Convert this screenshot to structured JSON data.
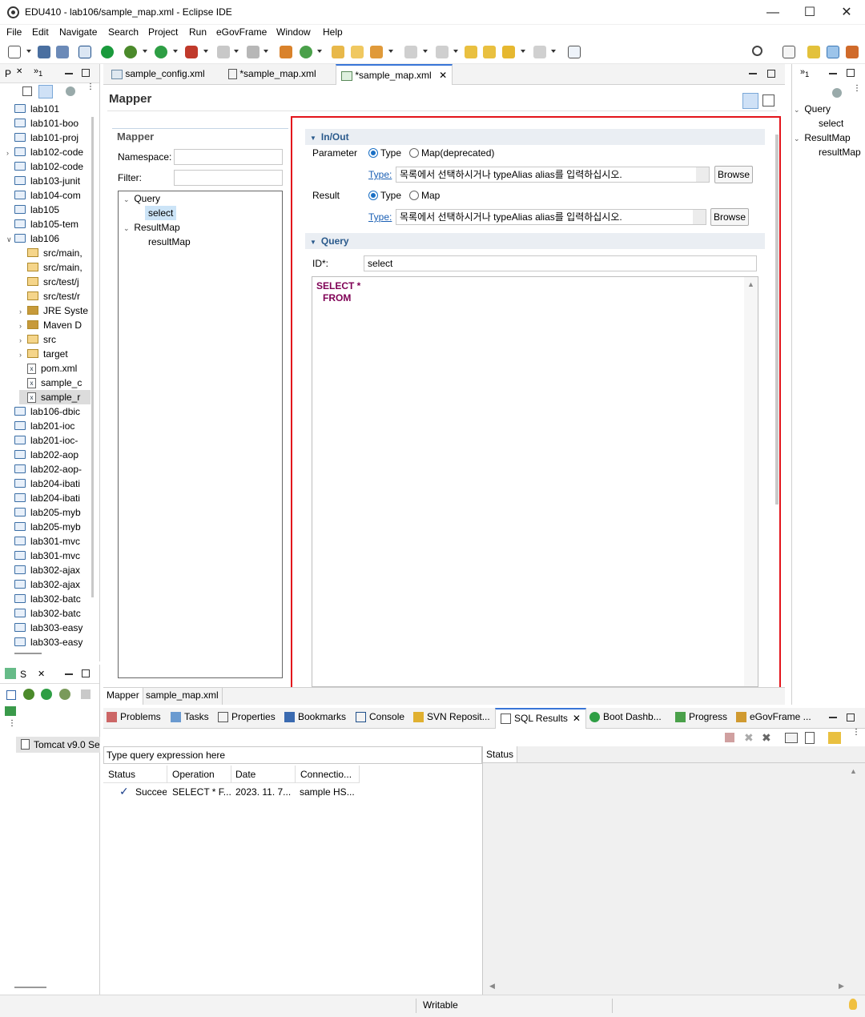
{
  "window": {
    "title": "EDU410 - lab106/sample_map.xml - Eclipse IDE"
  },
  "menu": [
    "File",
    "Edit",
    "Navigate",
    "Search",
    "Project",
    "Run",
    "eGovFrame",
    "Window",
    "Help"
  ],
  "package_explorer": {
    "tab_label": "P",
    "items": [
      {
        "label": "lab101",
        "level": 0,
        "kind": "folder"
      },
      {
        "label": "lab101-boo",
        "level": 0,
        "kind": "folder"
      },
      {
        "label": "lab101-proj",
        "level": 0,
        "kind": "folder"
      },
      {
        "label": "lab102-code",
        "level": 0,
        "kind": "folder",
        "twisty": true
      },
      {
        "label": "lab102-code",
        "level": 0,
        "kind": "folder"
      },
      {
        "label": "lab103-junit",
        "level": 0,
        "kind": "folder"
      },
      {
        "label": "lab104-com",
        "level": 0,
        "kind": "folder"
      },
      {
        "label": "lab105",
        "level": 0,
        "kind": "folder"
      },
      {
        "label": "lab105-tem",
        "level": 0,
        "kind": "folder"
      },
      {
        "label": "lab106",
        "level": 0,
        "kind": "folder",
        "twisty": true,
        "open": true
      },
      {
        "label": "src/main,",
        "level": 1,
        "kind": "pfolder"
      },
      {
        "label": "src/main,",
        "level": 1,
        "kind": "pfolder"
      },
      {
        "label": "src/test/j",
        "level": 1,
        "kind": "pfolder"
      },
      {
        "label": "src/test/r",
        "level": 1,
        "kind": "pfolder"
      },
      {
        "label": "JRE Syste",
        "level": 1,
        "kind": "lib",
        "twisty": true
      },
      {
        "label": "Maven D",
        "level": 1,
        "kind": "lib",
        "twisty": true
      },
      {
        "label": "src",
        "level": 1,
        "kind": "pfolder",
        "twisty": true
      },
      {
        "label": "target",
        "level": 1,
        "kind": "pfolder",
        "twisty": true
      },
      {
        "label": "pom.xml",
        "level": 1,
        "kind": "file"
      },
      {
        "label": "sample_c",
        "level": 1,
        "kind": "file"
      },
      {
        "label": "sample_r",
        "level": 1,
        "kind": "file",
        "selected": true
      },
      {
        "label": "lab106-dbic",
        "level": 0,
        "kind": "folder"
      },
      {
        "label": "lab201-ioc",
        "level": 0,
        "kind": "folder"
      },
      {
        "label": "lab201-ioc-",
        "level": 0,
        "kind": "folder"
      },
      {
        "label": "lab202-aop",
        "level": 0,
        "kind": "folder"
      },
      {
        "label": "lab202-aop-",
        "level": 0,
        "kind": "folder"
      },
      {
        "label": "lab204-ibati",
        "level": 0,
        "kind": "folder"
      },
      {
        "label": "lab204-ibati",
        "level": 0,
        "kind": "folder"
      },
      {
        "label": "lab205-myb",
        "level": 0,
        "kind": "folder"
      },
      {
        "label": "lab205-myb",
        "level": 0,
        "kind": "folder"
      },
      {
        "label": "lab301-mvc",
        "level": 0,
        "kind": "folder"
      },
      {
        "label": "lab301-mvc",
        "level": 0,
        "kind": "folder"
      },
      {
        "label": "lab302-ajax",
        "level": 0,
        "kind": "folder"
      },
      {
        "label": "lab302-ajax",
        "level": 0,
        "kind": "folder"
      },
      {
        "label": "lab302-batc",
        "level": 0,
        "kind": "folder"
      },
      {
        "label": "lab302-batc",
        "level": 0,
        "kind": "folder"
      },
      {
        "label": "lab303-easy",
        "level": 0,
        "kind": "folder"
      },
      {
        "label": "lab303-easy",
        "level": 0,
        "kind": "folder"
      }
    ]
  },
  "servers": {
    "tab_label": "S",
    "server": "Tomcat v9.0 Se"
  },
  "editor": {
    "tabs": [
      {
        "label": "sample_config.xml",
        "active": false
      },
      {
        "label": "*sample_map.xml",
        "active": false
      },
      {
        "label": "*sample_map.xml",
        "active": true
      }
    ],
    "title": "Mapper",
    "mapper_section": {
      "header": "Mapper",
      "namespace_label": "Namespace:",
      "namespace_value": "",
      "filter_label": "Filter:",
      "filter_value": "",
      "tree": {
        "query": "Query",
        "query_child": "select",
        "resultmap": "ResultMap",
        "resultmap_child": "resultMap"
      }
    },
    "inout": {
      "header": "In/Out",
      "parameter_label": "Parameter",
      "param_opt1": "Type",
      "param_opt2": "Map(deprecated)",
      "type_link": "Type:",
      "param_type_value": "목록에서 선택하시거나 typeAlias alias를 입력하십시오.",
      "browse": "Browse",
      "result_label": "Result",
      "result_opt1": "Type",
      "result_opt2": "Map",
      "result_type_value": "목록에서 선택하시거나 typeAlias alias를 입력하십시오."
    },
    "query": {
      "header": "Query",
      "id_label": "ID*:",
      "id_value": "select",
      "sql_line1": "SELECT *",
      "sql_line2": "FROM"
    },
    "bottom_tabs": [
      "Mapper",
      "sample_map.xml"
    ]
  },
  "outline": {
    "query": "Query",
    "query_child": "select",
    "resultmap": "ResultMap",
    "resultmap_child": "resultMap"
  },
  "bottom_panel": {
    "tabs": [
      "Problems",
      "Tasks",
      "Properties",
      "Bookmarks",
      "Console",
      "SVN Reposit...",
      "SQL Results",
      "Boot Dashb...",
      "Progress",
      "eGovFrame ..."
    ],
    "query_placeholder": "Type query expression here",
    "columns": [
      "Status",
      "Operation",
      "Date",
      "Connectio..."
    ],
    "rows": [
      {
        "status": "Succeed",
        "operation": "SELECT * F...",
        "date": "2023. 11. 7...",
        "connection": "sample HS..."
      }
    ],
    "status_tab": "Status"
  },
  "statusbar": {
    "mode": "Writable"
  },
  "colors": {
    "accent": "#1a6fc4",
    "highlight_box": "#e3141b",
    "sql_keyword": "#7f0055"
  }
}
